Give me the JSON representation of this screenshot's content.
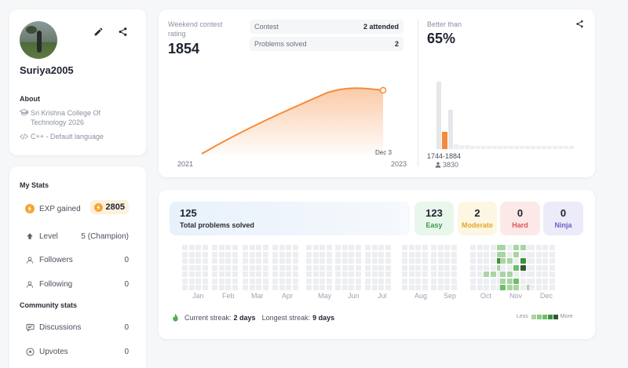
{
  "profile": {
    "username": "Suriya2005",
    "about_title": "About",
    "college": "Sri Krishna College Of Technology 2026",
    "language": "C++ - Default language"
  },
  "stats": {
    "title": "My Stats",
    "exp_label": "EXP gained",
    "exp_value": "2805",
    "level_label": "Level",
    "level_value": "5 (Champion)",
    "followers_label": "Followers",
    "followers_value": "0",
    "following_label": "Following",
    "following_value": "0"
  },
  "community": {
    "title": "Community stats",
    "discussions_label": "Discussions",
    "discussions_value": "0",
    "upvotes_label": "Upvotes",
    "upvotes_value": "0"
  },
  "contest": {
    "rating_label": "Weekend contest rating",
    "rating_value": "1854",
    "contest_label": "Contest",
    "contest_value": "2 attended",
    "solved_label": "Problems solved",
    "solved_value": "2",
    "chart_start": "2021",
    "chart_end": "2023",
    "point_label": "Dec 3",
    "better_label": "Better than",
    "better_value": "65%",
    "range_label": "1744-1884",
    "range_count": "3830"
  },
  "problems": {
    "total_value": "125",
    "total_label": "Total problems solved",
    "easy_value": "123",
    "easy_label": "Easy",
    "moderate_value": "2",
    "moderate_label": "Moderate",
    "hard_value": "0",
    "hard_label": "Hard",
    "ninja_value": "0",
    "ninja_label": "Ninja",
    "months": [
      "Jan",
      "Feb",
      "Mar",
      "Apr",
      "May",
      "Jun",
      "Jul",
      "Aug",
      "Sep",
      "Oct",
      "Nov",
      "Dec"
    ],
    "current_streak_label": "Current streak:",
    "current_streak_value": "2 days",
    "longest_streak_label": "Longest streak:",
    "longest_streak_value": "9 days",
    "legend_less": "Less",
    "legend_more": "More"
  },
  "colors": {
    "accent": "#f58a3c",
    "easy": "#e9f6ec",
    "moderate": "#fdf6e3",
    "hard": "#fde8e8",
    "ninja": "#ecebfa",
    "heat0": "#eceef2",
    "heat1": "#a8d5a2",
    "heat2": "#6cbf6a",
    "heat3": "#3f8f43",
    "heat4": "#2d5a2f"
  },
  "icons": [
    "edit-icon",
    "share-icon",
    "graduation-cap-icon",
    "code-icon",
    "lightning-icon",
    "arrow-up-icon",
    "user-icon",
    "chat-icon",
    "upvote-icon",
    "flame-icon",
    "person-icon"
  ]
}
